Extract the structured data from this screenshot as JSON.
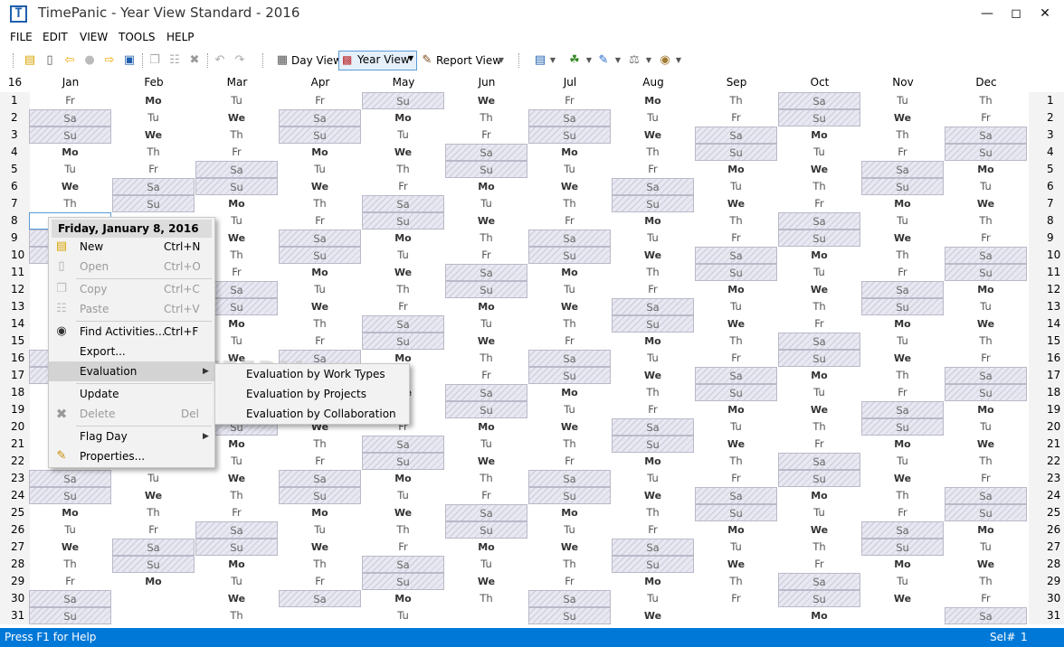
{
  "window": {
    "title": "TimePanic - Year View Standard - 2016",
    "app_icon_letter": "T"
  },
  "menu": [
    "FILE",
    "EDIT",
    "VIEW",
    "TOOLS",
    "HELP"
  ],
  "toolbar": {
    "day_view": "Day View",
    "year_view": "Year View",
    "report_view": "Report View"
  },
  "grid": {
    "corner": "16",
    "months": [
      "Jan",
      "Feb",
      "Mar",
      "Apr",
      "May",
      "Jun",
      "Jul",
      "Aug",
      "Sep",
      "Oct",
      "Nov",
      "Dec"
    ],
    "month_lengths": [
      31,
      29,
      31,
      30,
      31,
      30,
      31,
      31,
      30,
      31,
      30,
      31
    ],
    "first_weekday": [
      5,
      1,
      2,
      5,
      0,
      3,
      5,
      1,
      4,
      6,
      2,
      4
    ],
    "weekday_abbr": [
      "Su",
      "Mo",
      "Tu",
      "We",
      "Th",
      "Fr",
      "Sa"
    ],
    "rows": 31
  },
  "context_menu": {
    "header": "Friday, January 8, 2016",
    "items": [
      {
        "label": "New",
        "shortcut": "Ctrl+N",
        "icon": "new-note-icon",
        "enabled": true
      },
      {
        "label": "Open",
        "shortcut": "Ctrl+O",
        "icon": "open-icon",
        "enabled": false
      },
      {
        "label": "Copy",
        "shortcut": "Ctrl+C",
        "icon": "copy-icon",
        "enabled": false
      },
      {
        "label": "Paste",
        "shortcut": "Ctrl+V",
        "icon": "paste-icon",
        "enabled": false
      },
      {
        "label": "Find Activities...",
        "shortcut": "Ctrl+F",
        "icon": "binoculars-icon",
        "enabled": true
      },
      {
        "label": "Export...",
        "shortcut": "",
        "icon": "",
        "enabled": true
      },
      {
        "label": "Evaluation",
        "shortcut": "",
        "icon": "",
        "enabled": true,
        "submenu": true
      },
      {
        "label": "Update",
        "shortcut": "",
        "icon": "",
        "enabled": true
      },
      {
        "label": "Delete",
        "shortcut": "Del",
        "icon": "delete-icon",
        "enabled": false
      },
      {
        "label": "Flag Day",
        "shortcut": "",
        "icon": "",
        "enabled": true,
        "submenu": true
      },
      {
        "label": "Properties...",
        "shortcut": "",
        "icon": "pencil-icon",
        "enabled": true
      }
    ]
  },
  "submenu": [
    "Evaluation by Work Types",
    "Evaluation by Projects",
    "Evaluation by Collaboration"
  ],
  "watermark": "SOFTPEDIA",
  "status": {
    "left": "Press F1 for Help",
    "sel_label": "Sel#",
    "sel_value": "1"
  },
  "colors": {
    "accent": "#0078d7",
    "weekend": "#e8e8f2"
  }
}
